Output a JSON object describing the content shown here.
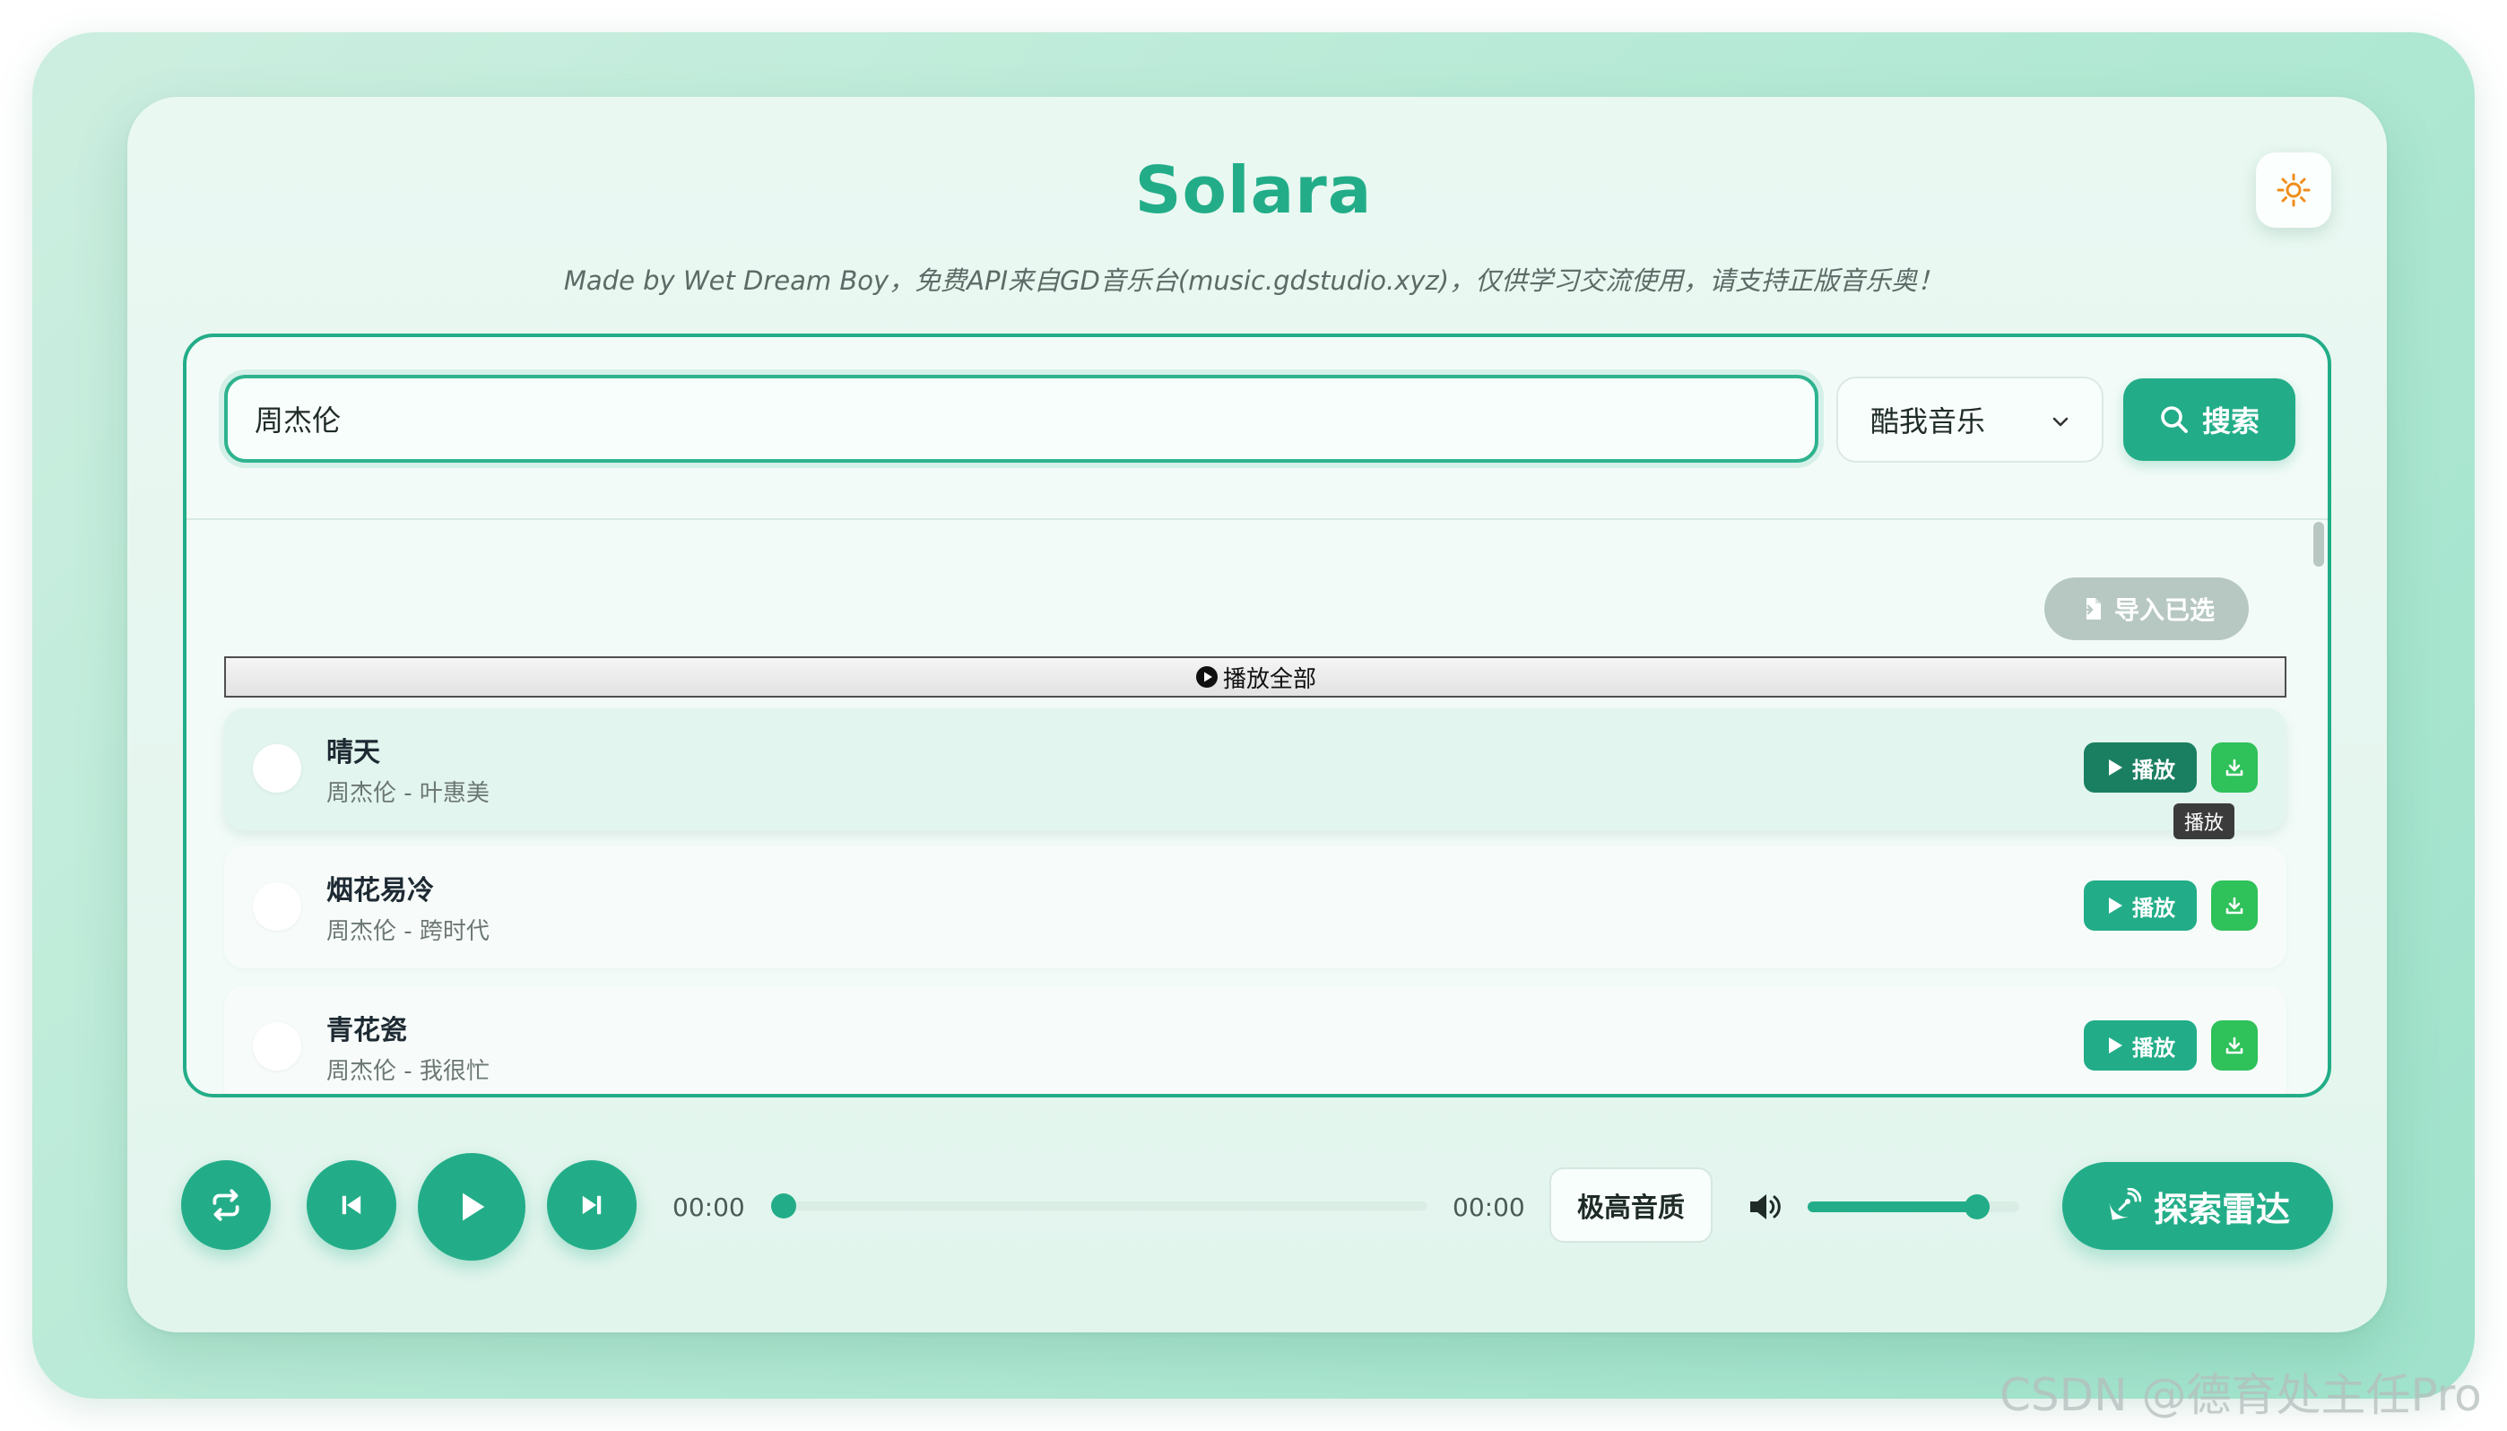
{
  "app": {
    "title": "Solara",
    "subtitle": "Made by Wet Dream Boy，免费API来自GD音乐台(music.gdstudio.xyz)，仅供学习交流使用，请支持正版音乐奥！"
  },
  "theme_toggle": {
    "icon": "sun-icon"
  },
  "search": {
    "query": "周杰伦",
    "source": "酷我音乐",
    "button_label": "搜索"
  },
  "actions": {
    "import_selected_label": "导入已选",
    "play_all_label": "播放全部"
  },
  "songs": [
    {
      "title": "晴天",
      "meta": "周杰伦 - 叶惠美",
      "play_label": "播放",
      "active": true
    },
    {
      "title": "烟花易冷",
      "meta": "周杰伦 - 跨时代",
      "play_label": "播放",
      "active": false
    },
    {
      "title": "青花瓷",
      "meta": "周杰伦 - 我很忙",
      "play_label": "播放",
      "active": false
    }
  ],
  "tooltip": {
    "text": "播放"
  },
  "player": {
    "current_time": "00:00",
    "total_time": "00:00",
    "progress": 0.0,
    "quality_label": "极高音质",
    "volume": 0.8,
    "radar_label": "探索雷达"
  },
  "watermark": "CSDN @德育处主任Pro",
  "colors": {
    "accent": "#22ad88",
    "accent_dark": "#1a7f61",
    "download": "#2fc15a",
    "disabled": "#b7c8c2"
  }
}
